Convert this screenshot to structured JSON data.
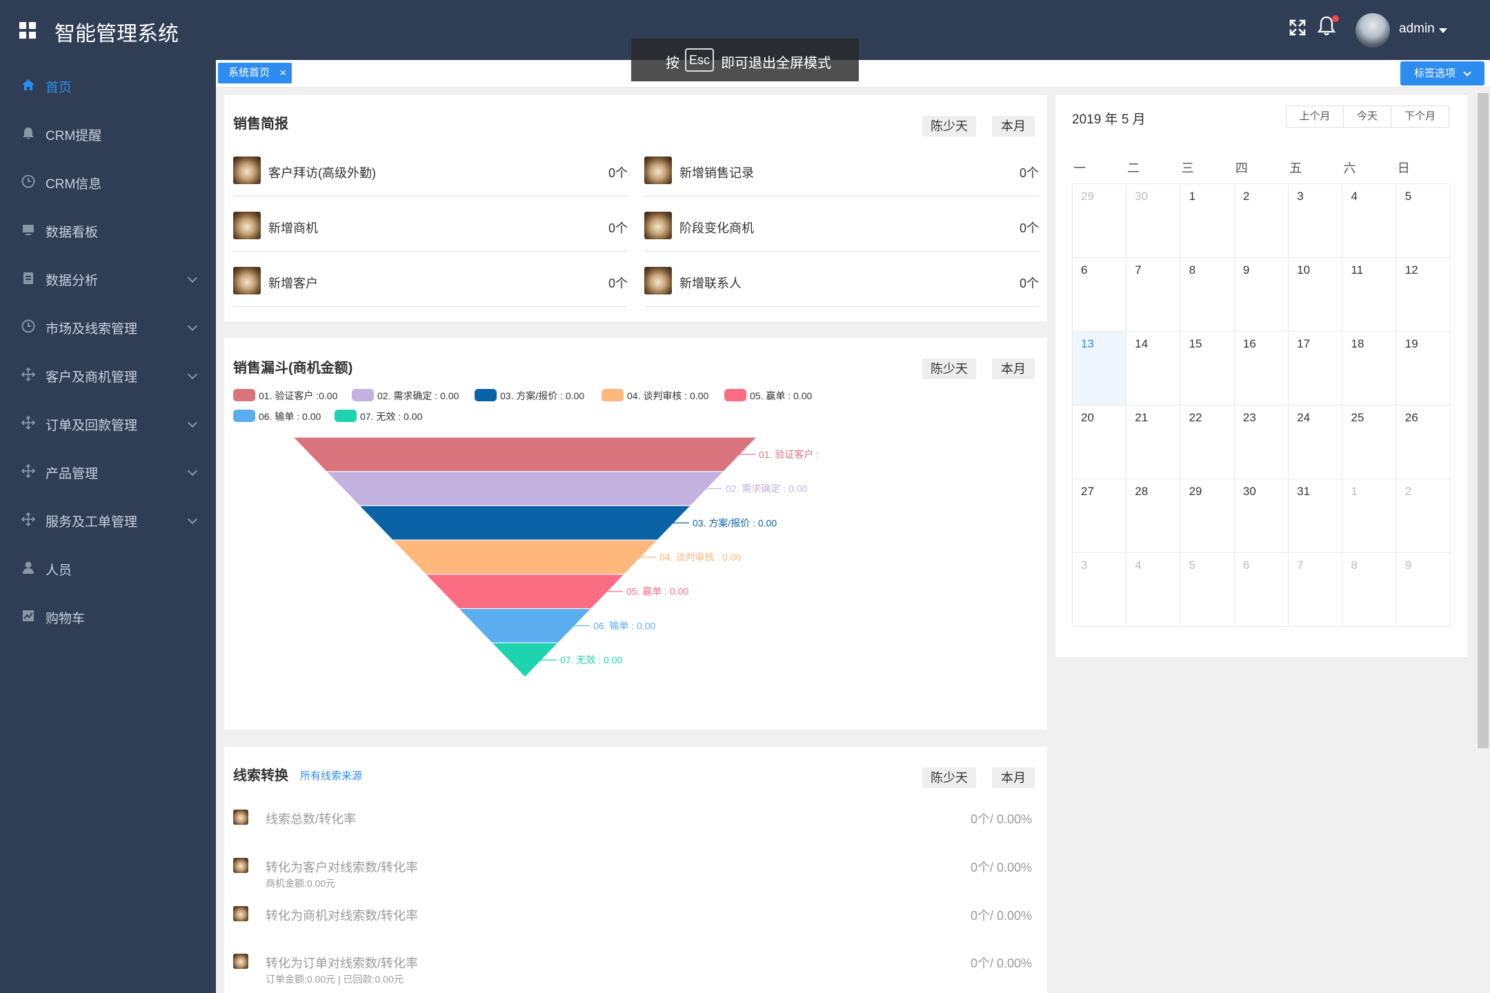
{
  "header": {
    "app_title": "智能管理系统",
    "user_name": "admin"
  },
  "sidebar": {
    "items": [
      {
        "label": "首页",
        "icon": "home-icon",
        "active": true,
        "has_submenu": false
      },
      {
        "label": "CRM提醒",
        "icon": "bell-icon",
        "has_submenu": false
      },
      {
        "label": "CRM信息",
        "icon": "clock-icon",
        "has_submenu": false
      },
      {
        "label": "数据看板",
        "icon": "monitor-icon",
        "has_submenu": false
      },
      {
        "label": "数据分析",
        "icon": "clipboard-icon",
        "has_submenu": true
      },
      {
        "label": "市场及线索管理",
        "icon": "clock-icon",
        "has_submenu": true
      },
      {
        "label": "客户及商机管理",
        "icon": "move-icon",
        "has_submenu": true
      },
      {
        "label": "订单及回款管理",
        "icon": "move-icon",
        "has_submenu": true
      },
      {
        "label": "产品管理",
        "icon": "move-icon",
        "has_submenu": true
      },
      {
        "label": "服务及工单管理",
        "icon": "move-icon",
        "has_submenu": true
      },
      {
        "label": "人员",
        "icon": "user-icon",
        "has_submenu": false
      },
      {
        "label": "购物车",
        "icon": "chart-icon",
        "has_submenu": false
      }
    ]
  },
  "tabs": {
    "home_tab": "系统首页",
    "close_glyph": "×",
    "options_label": "标签选项"
  },
  "esc_toast": {
    "prefix": "按",
    "key": "Esc",
    "suffix": "即可退出全屏模式"
  },
  "sales_brief": {
    "title": "销售简报",
    "btn_days": "陈少天",
    "btn_month": "本月",
    "items": [
      {
        "label": "客户拜访(高级外勤)",
        "value": "0个"
      },
      {
        "label": "新增销售记录",
        "value": "0个"
      },
      {
        "label": "新增商机",
        "value": "0个"
      },
      {
        "label": "阶段变化商机",
        "value": "0个"
      },
      {
        "label": "新增客户",
        "value": "0个"
      },
      {
        "label": "新增联系人",
        "value": "0个"
      }
    ]
  },
  "funnel": {
    "title": "销售漏斗(商机金额)",
    "btn_days": "陈少天",
    "btn_month": "本月"
  },
  "chart_data": {
    "type": "funnel",
    "title": "销售漏斗(商机金额)",
    "legend": "top-left",
    "series": [
      {
        "name": "01. 验证客户",
        "value": 0.0,
        "legend_text": "01. 验证客户 :0.00",
        "label": "01. 验证客户 :",
        "color": "#d9747d"
      },
      {
        "name": "02. 需求确定",
        "value": 0.0,
        "legend_text": "02. 需求确定 : 0.00",
        "label": "02. 需求确定 : 0.00",
        "color": "#c3b2e0"
      },
      {
        "name": "03. 方案/报价",
        "value": 0.0,
        "legend_text": "03. 方案/报价 : 0.00",
        "label": "03. 方案/报价 : 0.00",
        "color": "#0a63a6"
      },
      {
        "name": "04. 谈判审核",
        "value": 0.0,
        "legend_text": "04. 谈判审核 : 0.00",
        "label": "04. 谈判审核 : 0.00",
        "color": "#ffb77c"
      },
      {
        "name": "05. 赢单",
        "value": 0.0,
        "legend_text": "05. 赢单 : 0.00",
        "label": "05. 赢单 : 0.00",
        "color": "#fb6d82"
      },
      {
        "name": "06. 输单",
        "value": 0.0,
        "legend_text": "06. 输单 : 0.00",
        "label": "06. 输单 : 0.00",
        "color": "#5aaef0"
      },
      {
        "name": "07. 无效",
        "value": 0.0,
        "legend_text": "07. 无效 : 0.00",
        "label": "07. 无效 : 0.00",
        "color": "#1dd3b0"
      }
    ]
  },
  "leads": {
    "title": "线索转换",
    "source_link": "所有线索来源",
    "btn_days": "陈少天",
    "btn_month": "本月",
    "items": [
      {
        "label": "线索总数/转化率",
        "value": "0个/ 0.00%",
        "sub": ""
      },
      {
        "label": "转化为客户对线索数/转化率",
        "value": "0个/ 0.00%",
        "sub": "商机金额:0.00元"
      },
      {
        "label": "转化为商机对线索数/转化率",
        "value": "0个/ 0.00%",
        "sub": ""
      },
      {
        "label": "转化为订单对线索数/转化率",
        "value": "0个/ 0.00%",
        "sub": "订单金额:0.00元 | 已回款:0.00元"
      }
    ]
  },
  "calendar": {
    "title": "2019 年 5 月",
    "prev_btn": "上个月",
    "today_btn": "今天",
    "next_btn": "下个月",
    "weekdays": [
      "一",
      "二",
      "三",
      "四",
      "五",
      "六",
      "日"
    ],
    "days": [
      {
        "d": "29",
        "muted": true
      },
      {
        "d": "30",
        "muted": true
      },
      {
        "d": "1"
      },
      {
        "d": "2"
      },
      {
        "d": "3"
      },
      {
        "d": "4"
      },
      {
        "d": "5"
      },
      {
        "d": "6"
      },
      {
        "d": "7"
      },
      {
        "d": "8"
      },
      {
        "d": "9"
      },
      {
        "d": "10"
      },
      {
        "d": "11"
      },
      {
        "d": "12"
      },
      {
        "d": "13",
        "today": true
      },
      {
        "d": "14"
      },
      {
        "d": "15"
      },
      {
        "d": "16"
      },
      {
        "d": "17"
      },
      {
        "d": "18"
      },
      {
        "d": "19"
      },
      {
        "d": "20"
      },
      {
        "d": "21"
      },
      {
        "d": "22"
      },
      {
        "d": "23"
      },
      {
        "d": "24"
      },
      {
        "d": "25"
      },
      {
        "d": "26"
      },
      {
        "d": "27"
      },
      {
        "d": "28"
      },
      {
        "d": "29"
      },
      {
        "d": "30"
      },
      {
        "d": "31"
      },
      {
        "d": "1",
        "muted": true
      },
      {
        "d": "2",
        "muted": true
      },
      {
        "d": "3",
        "muted": true
      },
      {
        "d": "4",
        "muted": true
      },
      {
        "d": "5",
        "muted": true
      },
      {
        "d": "6",
        "muted": true
      },
      {
        "d": "7",
        "muted": true
      },
      {
        "d": "8",
        "muted": true
      },
      {
        "d": "9",
        "muted": true
      }
    ]
  },
  "colors": {
    "header_bg": "#2f3d55",
    "accent": "#2d8cf0",
    "today_bg": "#f0f6fe"
  }
}
